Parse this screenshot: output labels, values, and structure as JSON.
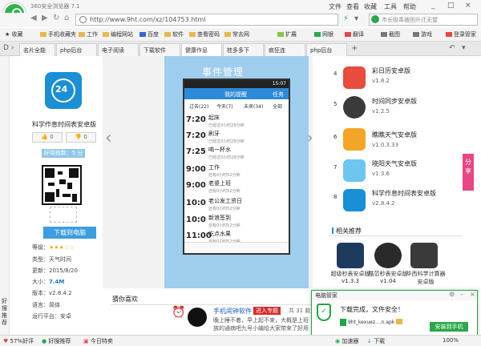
{
  "window": {
    "title": "360安全浏览器 7.1"
  },
  "menu": [
    "文件",
    "查看",
    "收藏",
    "工具",
    "帮助"
  ],
  "window_controls": [
    "_",
    "□",
    "×"
  ],
  "address": {
    "url": "http://www.9ht.com/xz/104753.html"
  },
  "search": {
    "text": "市长吸毒被困升迁无望"
  },
  "bookmarks": [
    "收藏",
    "手机收藏夹",
    "工作",
    "编程网站",
    "百度",
    "软件",
    "查看密码",
    "常去网",
    "扩展",
    "网银",
    "翻译",
    "截图",
    "游戏",
    "登录管家"
  ],
  "tabs": [
    "名片全能",
    "php后台",
    "电子阅读",
    "下载软件",
    "健康作息",
    "桂多多下",
    "疯狂连",
    "php后台"
  ],
  "left_sidebar": {
    "label": "好搜推荐"
  },
  "app": {
    "icon_text": "24",
    "name": "科学作息时间表安卓版",
    "vote_up": "0",
    "vote_down": "0",
    "rating_label": "好用指数：5 分",
    "download_label": "下载到电脑",
    "grade_label": "等级：",
    "stars": "★★★☆☆",
    "type": "类型：天气时间",
    "updated": "更新：2015/8/20",
    "size_label": "大小：",
    "size_value": "7.4M",
    "version": "版本：v2.8.4.2",
    "language": "语言：简体",
    "platform": "运行平台：安卓"
  },
  "screenshot": {
    "caption": "事件管理",
    "status_time": "15:07",
    "header_left": "我的提醒",
    "header_right": "任务",
    "filter_tabs": [
      "过去(22)",
      "今天(7)",
      "未来(34)",
      "全部"
    ],
    "rows": [
      {
        "time": "7:20",
        "title": "起床",
        "sub": "已经过0小时29分钟"
      },
      {
        "time": "7:20",
        "title": "刷牙",
        "sub": "已经过0小时29分钟"
      },
      {
        "time": "7:25",
        "title": "喝一杯水",
        "sub": "已经过0小时29分钟"
      },
      {
        "time": "9:00",
        "title": "工作",
        "sub": "还有0小时52分钟"
      },
      {
        "time": "9:00",
        "title": "老婆上班",
        "sub": "还有0小时52分钟"
      },
      {
        "time": "10:0",
        "title": "老公发工资日",
        "sub": "还有0小时52分钟"
      },
      {
        "time": "10:0",
        "title": "新浪签到",
        "sub": "还有0小时52分钟"
      },
      {
        "time": "11:00",
        "title": "吃点水果",
        "sub": "还有0小时52分钟"
      }
    ]
  },
  "right_list": [
    {
      "num": "4",
      "name": "彩日历安卓版",
      "ver": "v1.8.2"
    },
    {
      "num": "5",
      "name": "时间同步安卓版",
      "ver": "v1.2.5"
    },
    {
      "num": "6",
      "name": "瞧瞧天气安卓版",
      "ver": "v1.0.3.33"
    },
    {
      "num": "7",
      "name": "晓阳天气安卓版",
      "ver": "v1.3.6"
    },
    {
      "num": "8",
      "name": "科学作息时间表安卓版",
      "ver": "v2.8.4.2"
    }
  ],
  "share_label": "分享",
  "related": {
    "title": "相关推荐",
    "items": [
      {
        "name": "超级秒表安卓版v1.3.3"
      },
      {
        "name": "酷范秒表安卓版v1.04"
      },
      {
        "name": "华西科学计算器安卓版"
      }
    ]
  },
  "guess": {
    "title": "猜你喜欢",
    "ad_title": "手机闹钟软件",
    "ad_tag": "进入专题",
    "ad_count": "共 31 款",
    "ad_desc1": "晚上睡不着，早上起不来，大概是上班",
    "ad_desc2": "族的通病吧九号小编给大家带来了好用"
  },
  "popup": {
    "title": "电脑管家",
    "message": "下载完成，文件安全！",
    "filename": "9ht_kexuez....n.apk",
    "install_label": "安装到手机"
  },
  "statusbar": [
    "57%好评",
    "好搜推荐",
    "今日特卖",
    "加速器",
    "下载",
    "100%"
  ]
}
